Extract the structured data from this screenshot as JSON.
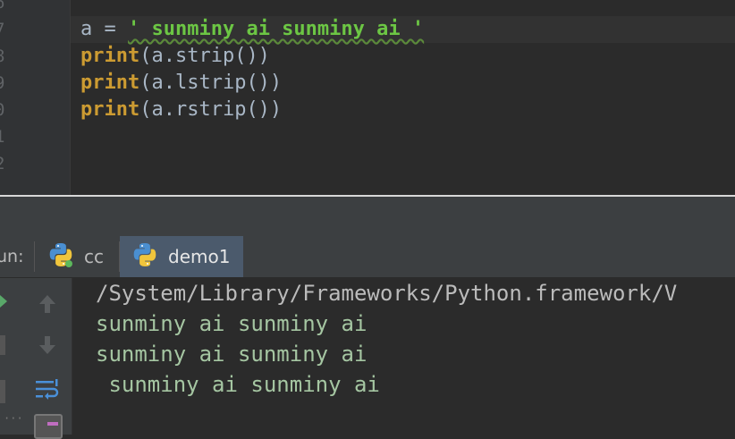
{
  "editor": {
    "line_numbers": [
      "6",
      "7",
      "8",
      "9",
      "0",
      "1",
      "2"
    ],
    "lines": [
      {
        "var": "a",
        "op": " = ",
        "string": "' sunminy ai sunminy ai '"
      },
      {
        "fn": "print",
        "arg": "(a.strip())"
      },
      {
        "fn": "print",
        "arg": "(a.lstrip())"
      },
      {
        "fn": "print",
        "arg": "(a.rstrip())"
      }
    ]
  },
  "run_panel": {
    "label": "un:",
    "tabs": [
      {
        "label": "cc",
        "icon": "python-icon",
        "active": false
      },
      {
        "label": "demo1",
        "icon": "python-icon",
        "active": true
      }
    ]
  },
  "console": {
    "lines": [
      "/System/Library/Frameworks/Python.framework/V",
      "sunminy ai sunminy ai",
      "sunminy ai sunminy ai",
      " sunminy ai sunminy ai"
    ]
  },
  "colors": {
    "editor_bg": "#2b2b2b",
    "string_green": "#6cc644",
    "builtin_orange": "#cc9b32",
    "console_output": "#a5c6a2",
    "active_tab": "#4b5a6c"
  }
}
